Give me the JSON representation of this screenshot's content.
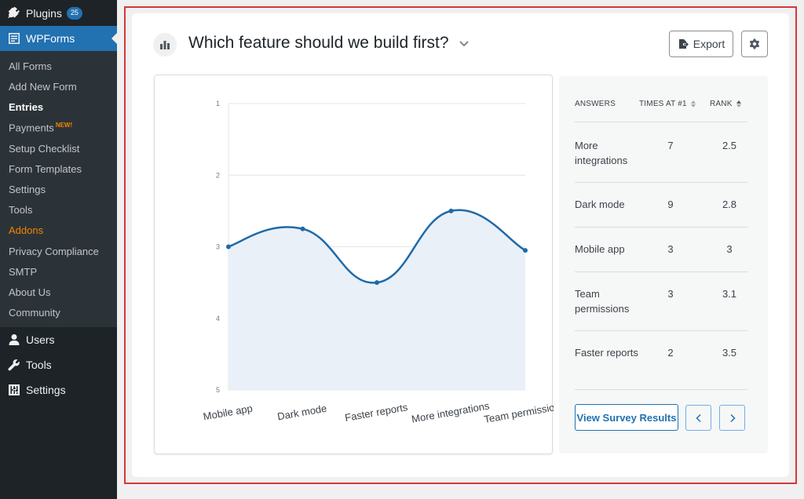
{
  "sidebar": {
    "plugins": {
      "label": "Plugins",
      "badge": "25"
    },
    "wpforms": {
      "label": "WPForms"
    },
    "submenu": [
      {
        "label": "All Forms"
      },
      {
        "label": "Add New Form"
      },
      {
        "label": "Entries",
        "current": true
      },
      {
        "label": "Payments",
        "new_badge": "NEW!"
      },
      {
        "label": "Setup Checklist"
      },
      {
        "label": "Form Templates"
      },
      {
        "label": "Settings"
      },
      {
        "label": "Tools"
      },
      {
        "label": "Addons"
      },
      {
        "label": "Privacy Compliance"
      },
      {
        "label": "SMTP"
      },
      {
        "label": "About Us"
      },
      {
        "label": "Community"
      }
    ],
    "users": {
      "label": "Users"
    },
    "tools": {
      "label": "Tools"
    },
    "settings": {
      "label": "Settings"
    }
  },
  "question": {
    "title": "Which feature should we build first?",
    "export_label": "Export"
  },
  "chart_data": {
    "type": "area",
    "categories": [
      "Mobile app",
      "Dark mode",
      "Faster reports",
      "More integrations",
      "Team permissions"
    ],
    "values": [
      3.0,
      2.75,
      3.5,
      2.5,
      3.05
    ],
    "ylim": [
      1,
      5
    ],
    "y_ticks": [
      "1",
      "2",
      "3",
      "4",
      "5"
    ],
    "y_inverted": true,
    "grid": true,
    "colors": {
      "line": "#1e6aa9",
      "fill": "#e9f0f8",
      "grid": "#e4e4e4"
    }
  },
  "table": {
    "headers": {
      "answers": "ANSWERS",
      "times": "TIMES AT #1",
      "rank": "RANK"
    },
    "rows": [
      {
        "answer": "More integrations",
        "times": "7",
        "rank": "2.5"
      },
      {
        "answer": "Dark mode",
        "times": "9",
        "rank": "2.8"
      },
      {
        "answer": "Mobile app",
        "times": "3",
        "rank": "3"
      },
      {
        "answer": "Team permissions",
        "times": "3",
        "rank": "3.1"
      },
      {
        "answer": "Faster reports",
        "times": "2",
        "rank": "3.5"
      }
    ],
    "view_button": "View Survey Results"
  },
  "colors": {
    "sidebar_bg": "#1d2327",
    "accent": "#2271b1",
    "highlight": "#d63638",
    "addons": "#f18500"
  }
}
